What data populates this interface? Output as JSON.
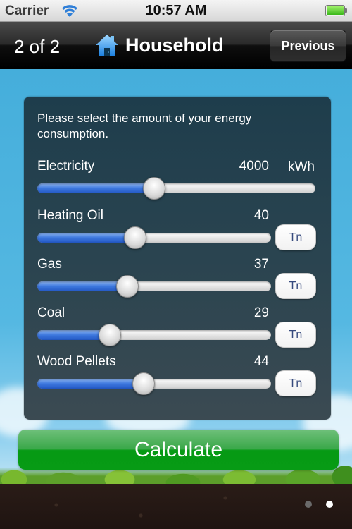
{
  "status_bar": {
    "carrier": "Carrier",
    "time": "10:57 AM",
    "wifi_icon": "wifi-icon",
    "battery_icon": "battery-icon",
    "battery_level": 1.0
  },
  "nav_bar": {
    "page_counter": "2 of 2",
    "title": "Household",
    "title_icon": "house-icon",
    "previous_label": "Previous"
  },
  "panel": {
    "instructions": "Please select the amount of your energy consumption.",
    "rows": [
      {
        "label": "Electricity",
        "value": "4000",
        "unit": "kWh",
        "unit_is_button": false,
        "slider_fraction": 0.42
      },
      {
        "label": "Heating Oil",
        "value": "40",
        "unit": "Tn",
        "unit_is_button": true,
        "slider_fraction": 0.42
      },
      {
        "label": "Gas",
        "value": "37",
        "unit": "Tn",
        "unit_is_button": true,
        "slider_fraction": 0.385
      },
      {
        "label": "Coal",
        "value": "29",
        "unit": "Tn",
        "unit_is_button": true,
        "slider_fraction": 0.31
      },
      {
        "label": "Wood Pellets",
        "value": "44",
        "unit": "Tn",
        "unit_is_button": true,
        "slider_fraction": 0.455
      }
    ]
  },
  "calculate_label": "Calculate",
  "page_control": {
    "total": 2,
    "current": 2
  },
  "colors": {
    "slider_fill": "#3d78de",
    "calculate_green": "#069a14",
    "unit_text": "#364a7d",
    "panel_bg": "#2a4450",
    "sky": "#45aedb"
  }
}
